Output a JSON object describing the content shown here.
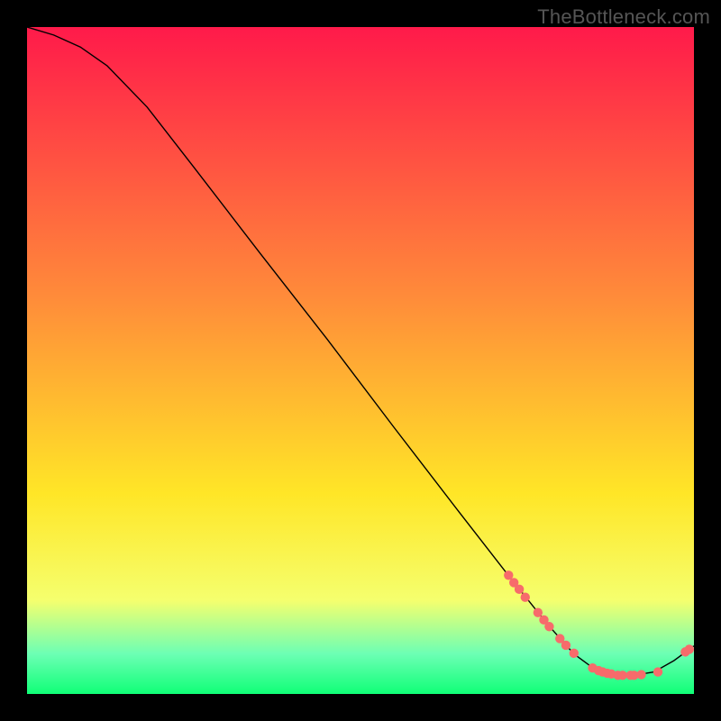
{
  "watermark": "TheBottleneck.com",
  "colors": {
    "gradient_top": "#ff1a4a",
    "gradient_mid1": "#ff6a3a",
    "gradient_mid2": "#ffe627",
    "gradient_band_top": "#f5ff6e",
    "gradient_band_mid": "#6cffb4",
    "gradient_bottom": "#10ff77",
    "point": "#f76b6b",
    "curve": "#000000"
  },
  "chart_data": {
    "type": "line",
    "title": "",
    "xlabel": "",
    "ylabel": "",
    "xlim": [
      0,
      100
    ],
    "ylim": [
      0,
      100
    ],
    "curve": [
      {
        "x": 0,
        "y": 100
      },
      {
        "x": 4,
        "y": 98.8
      },
      {
        "x": 8,
        "y": 97.0
      },
      {
        "x": 12,
        "y": 94.2
      },
      {
        "x": 18,
        "y": 88.0
      },
      {
        "x": 25,
        "y": 79.0
      },
      {
        "x": 35,
        "y": 66.0
      },
      {
        "x": 45,
        "y": 53.2
      },
      {
        "x": 55,
        "y": 40.0
      },
      {
        "x": 65,
        "y": 27.0
      },
      {
        "x": 72,
        "y": 18.0
      },
      {
        "x": 78,
        "y": 10.5
      },
      {
        "x": 82,
        "y": 6.0
      },
      {
        "x": 85,
        "y": 3.8
      },
      {
        "x": 88,
        "y": 2.8
      },
      {
        "x": 91,
        "y": 2.8
      },
      {
        "x": 94,
        "y": 3.3
      },
      {
        "x": 97,
        "y": 5.0
      },
      {
        "x": 100,
        "y": 7.2
      }
    ],
    "points": [
      {
        "x": 72.2,
        "y": 17.8
      },
      {
        "x": 73.0,
        "y": 16.7
      },
      {
        "x": 73.8,
        "y": 15.7
      },
      {
        "x": 74.7,
        "y": 14.5
      },
      {
        "x": 76.6,
        "y": 12.2
      },
      {
        "x": 77.5,
        "y": 11.1
      },
      {
        "x": 78.3,
        "y": 10.1
      },
      {
        "x": 79.9,
        "y": 8.3
      },
      {
        "x": 80.8,
        "y": 7.3
      },
      {
        "x": 82.0,
        "y": 6.1
      },
      {
        "x": 84.8,
        "y": 3.9
      },
      {
        "x": 85.7,
        "y": 3.5
      },
      {
        "x": 86.3,
        "y": 3.3
      },
      {
        "x": 87.0,
        "y": 3.1
      },
      {
        "x": 87.6,
        "y": 3.0
      },
      {
        "x": 88.6,
        "y": 2.8
      },
      {
        "x": 89.3,
        "y": 2.8
      },
      {
        "x": 90.5,
        "y": 2.8
      },
      {
        "x": 91.0,
        "y": 2.8
      },
      {
        "x": 92.1,
        "y": 2.9
      },
      {
        "x": 94.6,
        "y": 3.3
      },
      {
        "x": 98.7,
        "y": 6.3
      },
      {
        "x": 99.3,
        "y": 6.7
      }
    ]
  }
}
